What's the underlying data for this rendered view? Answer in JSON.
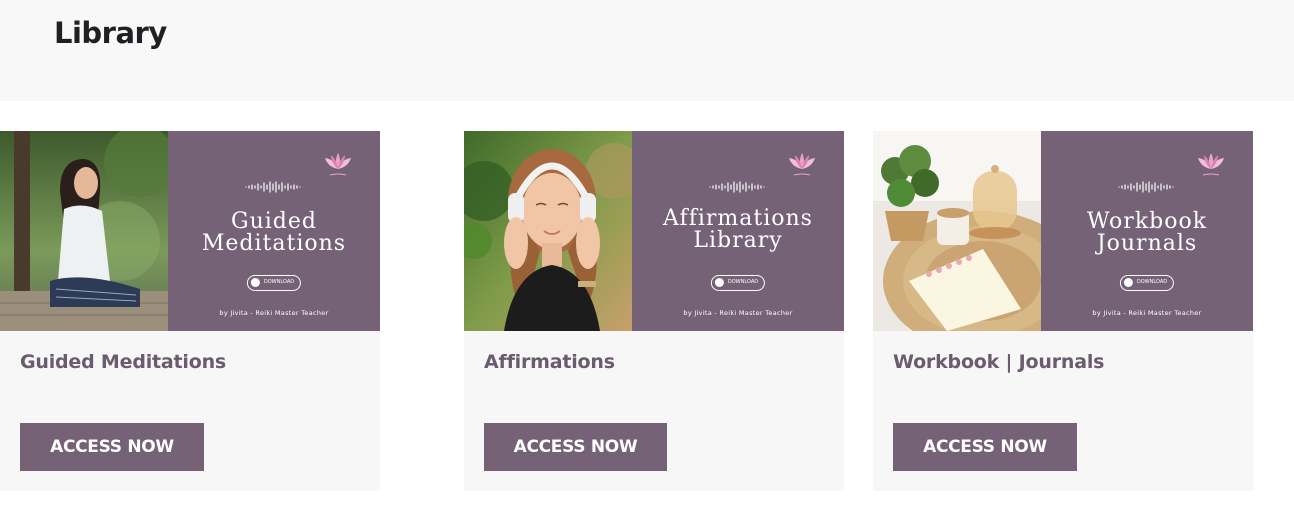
{
  "header": {
    "title": "Library"
  },
  "cards": [
    {
      "title": "Affirmations",
      "button": "ACCESS NOW",
      "banner": {
        "line1": "Affirmations",
        "line2": "Library",
        "download": "DOWNLOAD",
        "byline": "by Jivita - Reiki Master Teacher"
      }
    },
    {
      "title": "Workbook | Journals",
      "button": "ACCESS NOW",
      "banner": {
        "line1": "Workbook",
        "line2": "Journals",
        "download": "DOWNLOAD",
        "byline": "by Jivita - Reiki Master Teacher"
      }
    },
    {
      "title": "Guided Meditations",
      "button": "ACCESS NOW",
      "banner": {
        "line1": "Guided",
        "line2": "Meditations",
        "download": "DOWNLOAD",
        "byline": "by Jivita - Reiki Master Teacher"
      }
    }
  ],
  "colors": {
    "accent": "#756277",
    "title_text": "#6b5b6e",
    "header_bg": "#f8f8f8",
    "card_bg": "#f7f7f7"
  },
  "icons": [
    "sound-wave-icon",
    "lotus-logo-icon",
    "download-icon"
  ]
}
